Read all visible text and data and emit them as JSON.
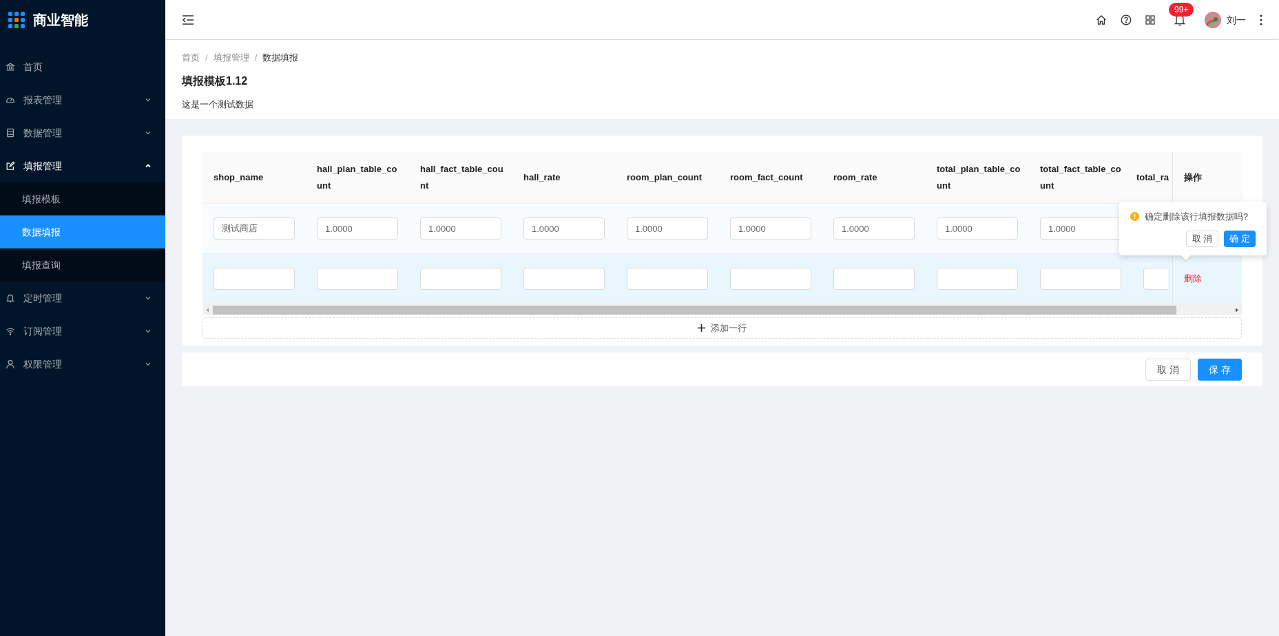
{
  "sidebar": {
    "logo": "商业智能",
    "items": [
      {
        "label": "首页"
      },
      {
        "label": "报表管理",
        "expanded": false
      },
      {
        "label": "数据管理",
        "expanded": false
      },
      {
        "label": "填报管理",
        "expanded": true,
        "children": [
          {
            "label": "填报模板",
            "selected": false
          },
          {
            "label": "数据填报",
            "selected": true
          },
          {
            "label": "填报查询",
            "selected": false
          }
        ]
      },
      {
        "label": "定时管理",
        "expanded": false
      },
      {
        "label": "订阅管理",
        "expanded": false
      },
      {
        "label": "权限管理",
        "expanded": false
      }
    ]
  },
  "header": {
    "notification_count": "99+",
    "user_name": "刘一"
  },
  "breadcrumb": [
    "首页",
    "填报管理",
    "数据填报"
  ],
  "breadcrumb_separator": "/",
  "title": "填报模板1.12",
  "description": "这是一个测试数据",
  "table": {
    "columns": [
      "shop_name",
      "hall_plan_table_count",
      "hall_fact_table_count",
      "hall_rate",
      "room_plan_count",
      "room_fact_count",
      "room_rate",
      "total_plan_table_count",
      "total_fact_table_count",
      "total_ra"
    ],
    "action_column": "操作",
    "rows": [
      {
        "highlighted": false,
        "values": [
          "测试商店",
          "1.0000",
          "1.0000",
          "1.0000",
          "1.0000",
          "1.0000",
          "1.0000",
          "1.0000",
          "1.0000"
        ]
      },
      {
        "highlighted": true,
        "action": "删除"
      }
    ],
    "add_row": "添加一行"
  },
  "popconfirm": {
    "message": "确定删除该行填报数据吗?",
    "cancel": "取 消",
    "ok": "确 定"
  },
  "footer": {
    "cancel": "取 消",
    "save": "保 存"
  }
}
